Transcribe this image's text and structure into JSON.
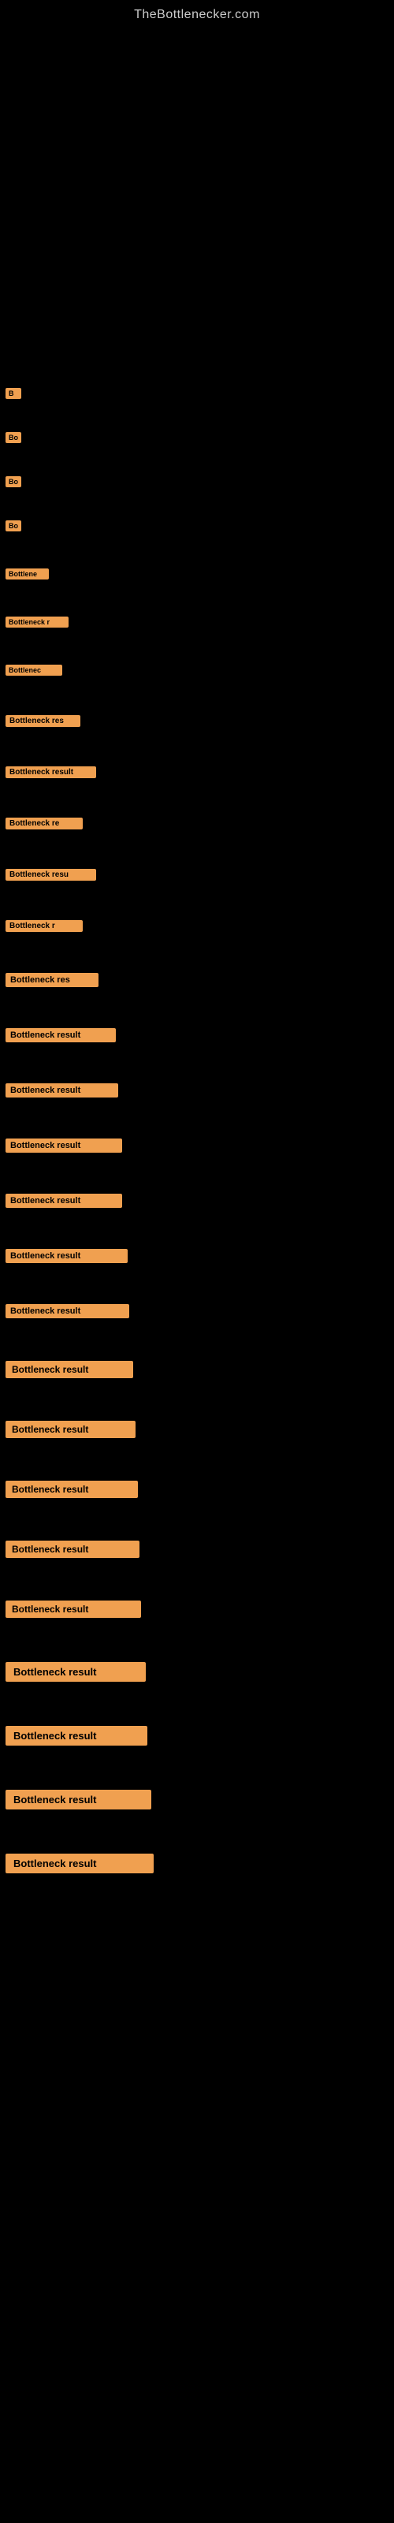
{
  "site": {
    "title": "TheBottlenecker.com"
  },
  "labels": {
    "bottleneck_result": "Bottleneck result",
    "bo": "Bo",
    "bottlene": "Bottlene",
    "bottlenec": "Bottlenec",
    "bottleneck_r": "Bottleneck r",
    "bottleneck_re": "Bottleneck re",
    "bottleneck_res": "Bottleneck res",
    "bottleneck_resu": "Bottleneck resu",
    "bottleneck_result_full": "Bottleneck result"
  },
  "rows": [
    {
      "id": 1,
      "label": "B",
      "size": "xs",
      "width": "w-20",
      "margin_top": 600
    },
    {
      "id": 2,
      "label": "Bo",
      "size": "xs",
      "width": "w-30",
      "margin_top": 100
    },
    {
      "id": 3,
      "label": "Bo",
      "size": "xs",
      "width": "w-30",
      "margin_top": 80
    },
    {
      "id": 4,
      "label": "Bo",
      "size": "xs",
      "width": "w-30",
      "margin_top": 70
    },
    {
      "id": 5,
      "label": "Bottlene",
      "size": "xs",
      "width": "w-60",
      "margin_top": 60
    },
    {
      "id": 6,
      "label": "Bottleneck r",
      "size": "xs",
      "width": "w-80",
      "margin_top": 50
    },
    {
      "id": 7,
      "label": "Bottlenec",
      "size": "xs",
      "width": "w-80",
      "margin_top": 45
    },
    {
      "id": 8,
      "label": "Bottleneck res",
      "size": "sm",
      "width": "w-100",
      "margin_top": 45
    },
    {
      "id": 9,
      "label": "Bottleneck result",
      "size": "sm",
      "width": "w-120",
      "margin_top": 40
    },
    {
      "id": 10,
      "label": "Bottleneck re",
      "size": "sm",
      "width": "w-100",
      "margin_top": 40
    },
    {
      "id": 11,
      "label": "Bottleneck resu",
      "size": "sm",
      "width": "w-120",
      "margin_top": 38
    },
    {
      "id": 12,
      "label": "Bottleneck r",
      "size": "sm",
      "width": "w-100",
      "margin_top": 38
    },
    {
      "id": 13,
      "label": "Bottleneck res",
      "size": "md",
      "width": "w-120",
      "margin_top": 36
    },
    {
      "id": 14,
      "label": "Bottleneck result",
      "size": "md",
      "width": "w-140",
      "margin_top": 35
    },
    {
      "id": 15,
      "label": "Bottleneck result",
      "size": "md",
      "width": "w-140",
      "margin_top": 34
    },
    {
      "id": 16,
      "label": "Bottleneck result",
      "size": "md",
      "width": "w-150",
      "margin_top": 33
    },
    {
      "id": 17,
      "label": "Bottleneck result",
      "size": "md",
      "width": "w-150",
      "margin_top": 32
    },
    {
      "id": 18,
      "label": "Bottleneck result",
      "size": "md",
      "width": "w-160",
      "margin_top": 32
    },
    {
      "id": 19,
      "label": "Bottleneck result",
      "size": "md",
      "width": "w-160",
      "margin_top": 31
    },
    {
      "id": 20,
      "label": "Bottleneck result",
      "size": "lg",
      "width": "w-170",
      "margin_top": 30
    },
    {
      "id": 21,
      "label": "Bottleneck result",
      "size": "lg",
      "width": "w-170",
      "margin_top": 30
    },
    {
      "id": 22,
      "label": "Bottleneck result",
      "size": "lg",
      "width": "w-180",
      "margin_top": 28
    },
    {
      "id": 23,
      "label": "Bottleneck result",
      "size": "lg",
      "width": "w-180",
      "margin_top": 28
    },
    {
      "id": 24,
      "label": "Bottleneck result",
      "size": "lg",
      "width": "w-180",
      "margin_top": 28
    },
    {
      "id": 25,
      "label": "Bottleneck result",
      "size": "xl",
      "width": "w-190",
      "margin_top": 26
    },
    {
      "id": 26,
      "label": "Bottleneck result",
      "size": "xl",
      "width": "w-190",
      "margin_top": 26
    },
    {
      "id": 27,
      "label": "Bottleneck result",
      "size": "xl",
      "width": "w-200",
      "margin_top": 25
    },
    {
      "id": 28,
      "label": "Bottleneck result",
      "size": "xl",
      "width": "w-200",
      "margin_top": 25
    }
  ]
}
